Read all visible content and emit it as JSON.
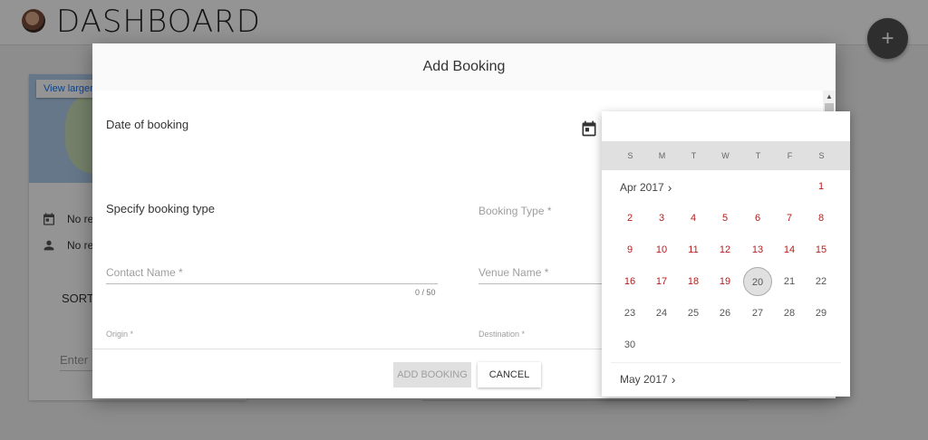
{
  "app": {
    "title": "DASHBOARD"
  },
  "fab": {
    "label": "+"
  },
  "card": {
    "map_link": "View larger map",
    "no_results_1": "No re",
    "no_results_2": "No re",
    "sort_label": "SORT",
    "enter_placeholder": "Enter"
  },
  "dialog": {
    "title": "Add Booking",
    "date_label": "Date of booking",
    "booking_type_label": "Specify booking type",
    "booking_type_placeholder": "Booking Type *",
    "contact_placeholder": "Contact Name *",
    "contact_counter": "0 / 50",
    "venue_placeholder": "Venue Name *",
    "origin_placeholder": "Origin *",
    "destination_placeholder": "Destination *",
    "add_button": "ADD BOOKING",
    "cancel_button": "CANCEL"
  },
  "datepicker": {
    "weekdays": [
      "S",
      "M",
      "T",
      "W",
      "T",
      "F",
      "S"
    ],
    "month_1": "Apr 2017",
    "month_2": "May 2017",
    "april_days": [
      "1",
      "2",
      "3",
      "4",
      "5",
      "6",
      "7",
      "8",
      "9",
      "10",
      "11",
      "12",
      "13",
      "14",
      "15",
      "16",
      "17",
      "18",
      "19",
      "20",
      "21",
      "22",
      "23",
      "24",
      "25",
      "26",
      "27",
      "28",
      "29",
      "30"
    ],
    "first_weekday": 6,
    "selectable_through": 19,
    "today": 20,
    "colors": {
      "available": "#b71c1c",
      "disabled": "#555555",
      "today_bg": "#e0e0e0"
    }
  }
}
